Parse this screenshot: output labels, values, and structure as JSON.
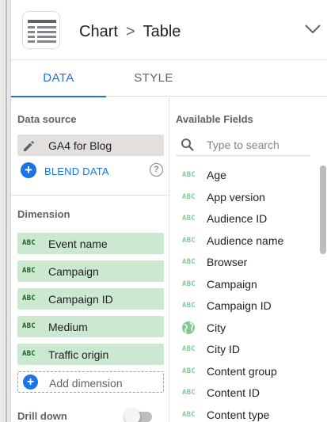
{
  "header": {
    "chart_type": "Chart",
    "separator": ">",
    "chart_subtype": "Table"
  },
  "tabs": [
    {
      "label": "DATA",
      "active": true
    },
    {
      "label": "STYLE",
      "active": false
    }
  ],
  "data_source": {
    "title": "Data source",
    "name": "GA4 for Blog",
    "blend_label": "BLEND DATA",
    "help_glyph": "?"
  },
  "dimension": {
    "title": "Dimension",
    "type_badge": "ABC",
    "items": [
      "Event name",
      "Campaign",
      "Campaign ID",
      "Medium",
      "Traffic origin"
    ],
    "add_label": "Add dimension"
  },
  "drill_down": {
    "label": "Drill down",
    "enabled": false
  },
  "available_fields": {
    "title": "Available Fields",
    "search_placeholder": "Type to search",
    "items": [
      {
        "label": "Age",
        "icon": "abc-text-icon"
      },
      {
        "label": "App version",
        "icon": "abc-text-icon"
      },
      {
        "label": "Audience ID",
        "icon": "abc-text-icon"
      },
      {
        "label": "Audience name",
        "icon": "abc-text-icon"
      },
      {
        "label": "Browser",
        "icon": "abc-text-icon"
      },
      {
        "label": "Campaign",
        "icon": "abc-text-icon"
      },
      {
        "label": "Campaign ID",
        "icon": "abc-text-icon"
      },
      {
        "label": "City",
        "icon": "globe-icon"
      },
      {
        "label": "City ID",
        "icon": "abc-text-icon"
      },
      {
        "label": "Content group",
        "icon": "abc-text-icon"
      },
      {
        "label": "Content ID",
        "icon": "abc-text-icon"
      },
      {
        "label": "Content type",
        "icon": "abc-text-icon"
      }
    ]
  },
  "colors": {
    "accent": "#1a73e8",
    "dimension_chip": "#cde8d0",
    "data_source_chip": "#e3dfdc",
    "field_type_icon": "#81c995"
  }
}
